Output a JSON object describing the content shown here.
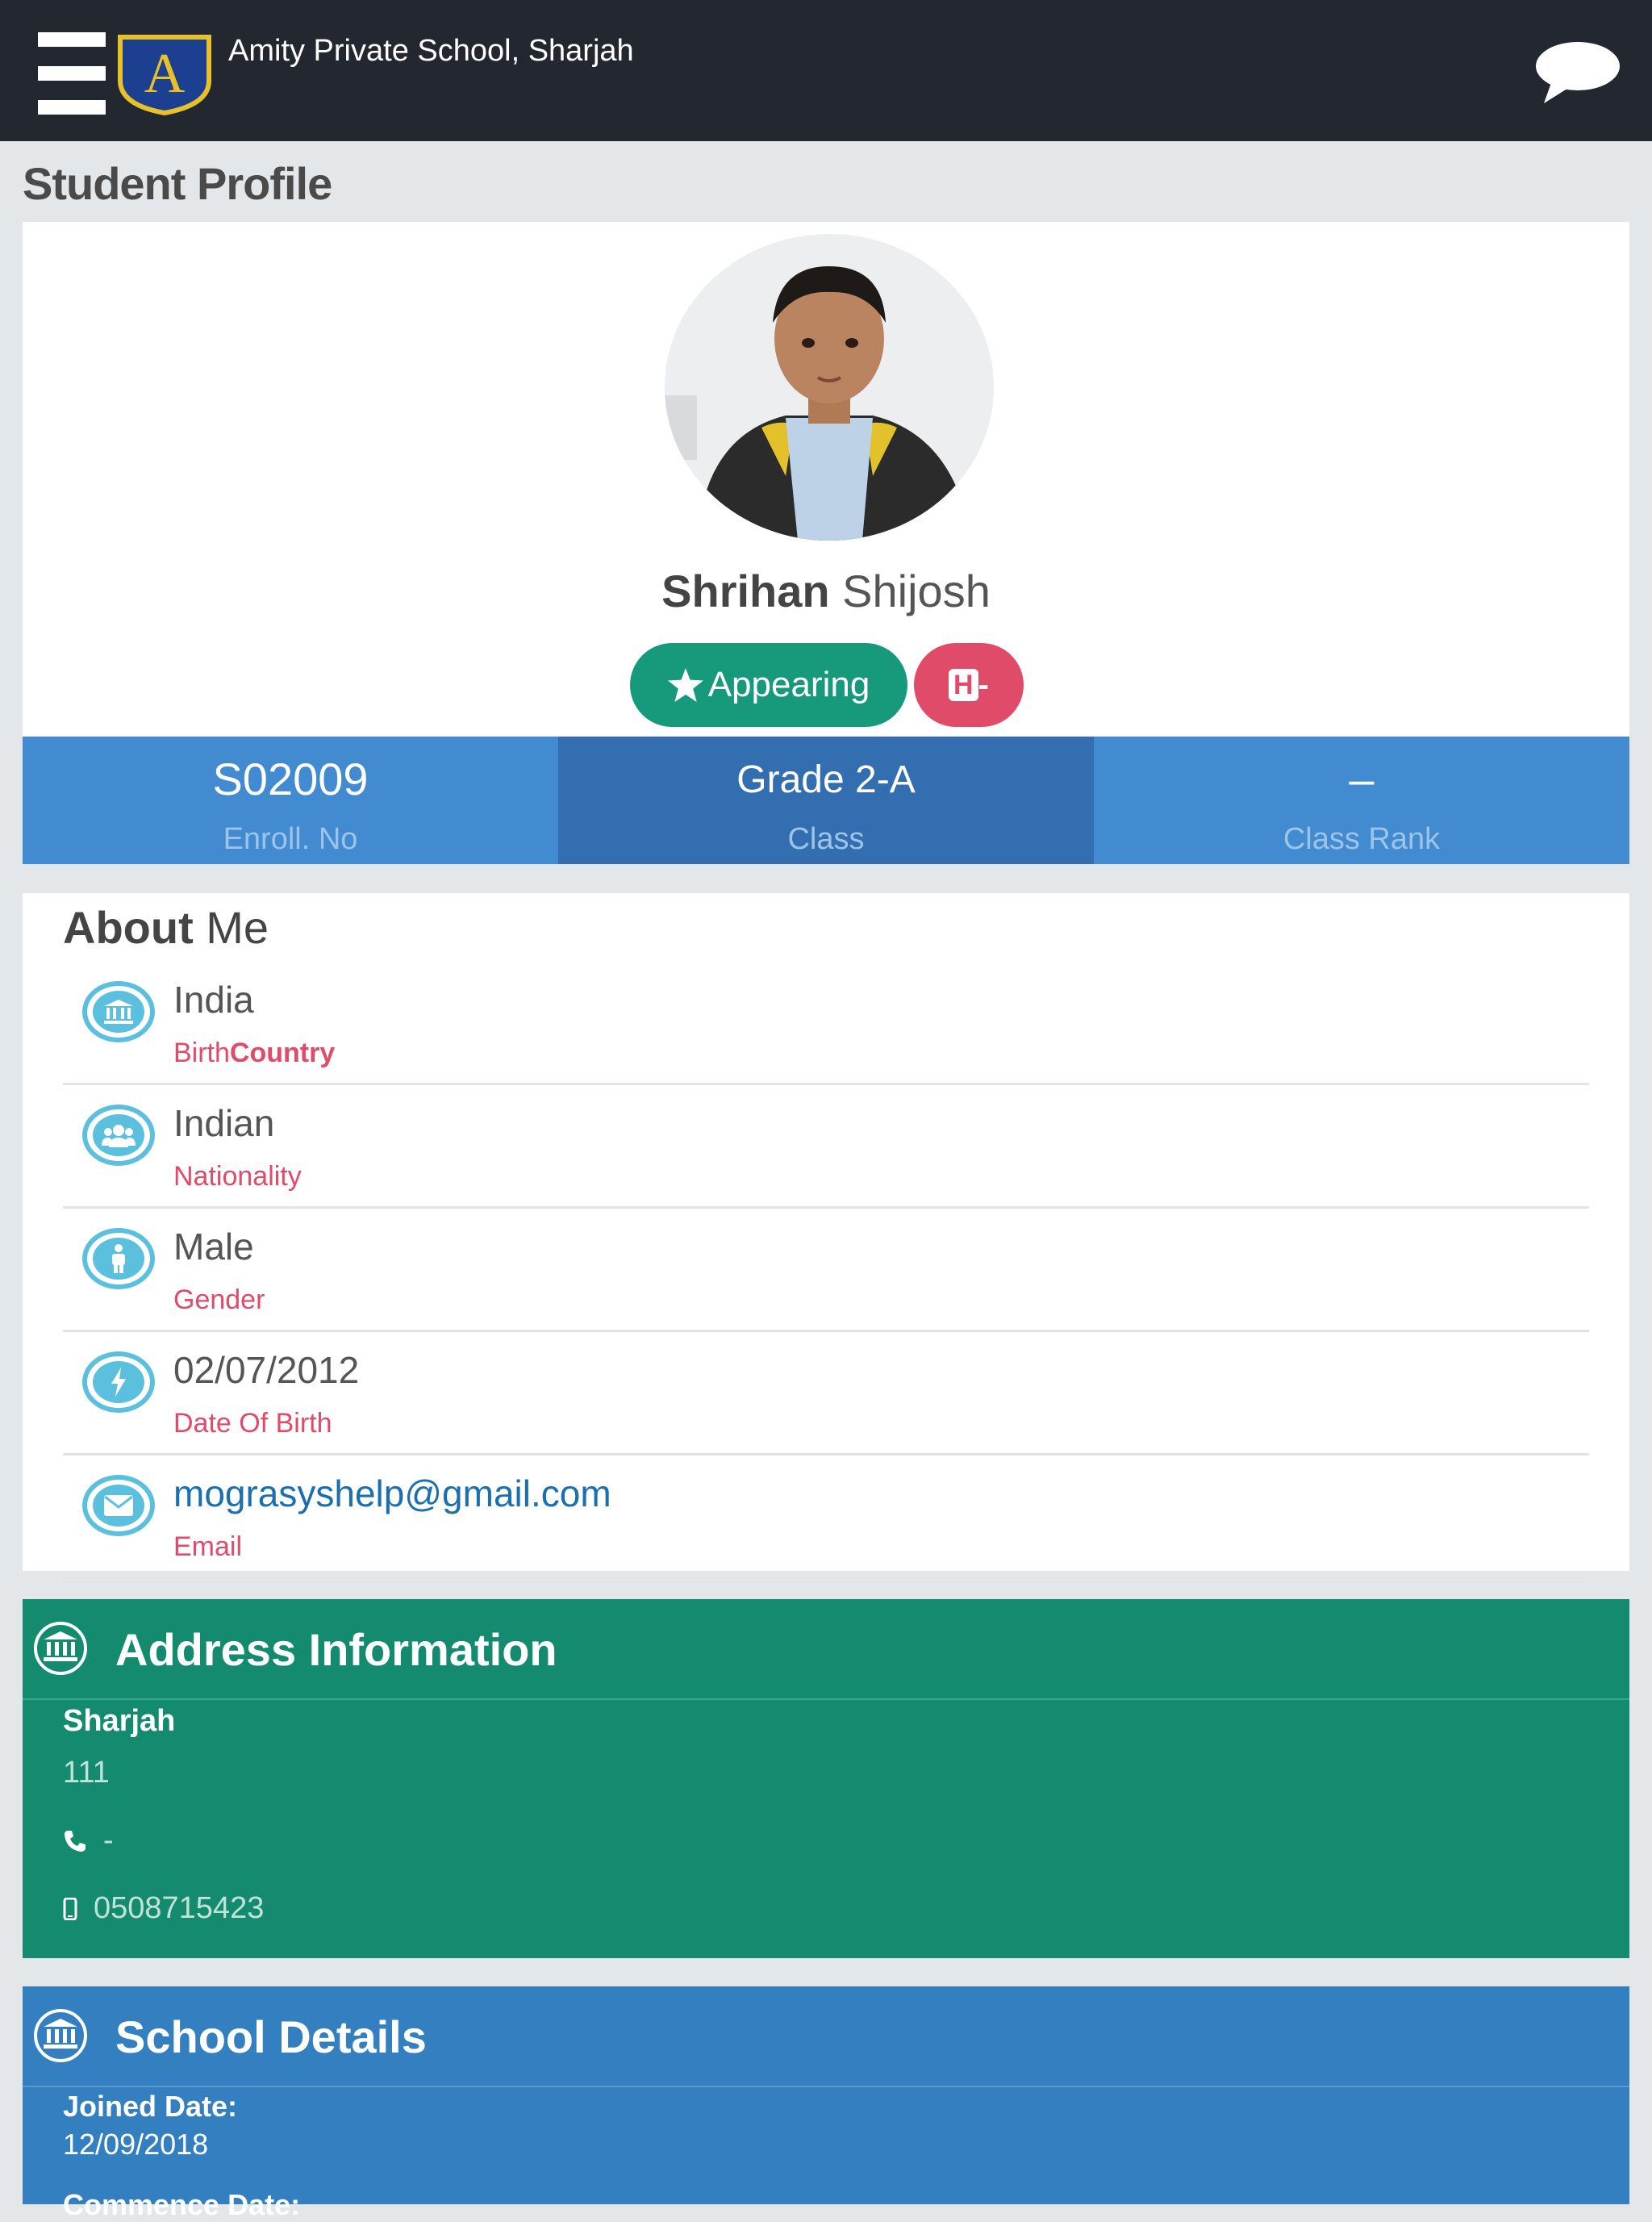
{
  "header": {
    "school_name": "Amity Private School, Sharjah",
    "logo_letter": "A"
  },
  "page": {
    "title": "Student Profile"
  },
  "profile": {
    "first_name": "Shrihan",
    "last_name": "Shijosh",
    "status_badge": "Appearing",
    "blood_group_prefix": "H",
    "blood_group": "-"
  },
  "stats": [
    {
      "value": "S02009",
      "label": "Enroll. No"
    },
    {
      "value": "Grade 2-A",
      "label": "Class"
    },
    {
      "value": "–",
      "label": "Class Rank"
    }
  ],
  "about": {
    "title_bold": "About",
    "title_rest": "Me",
    "rows": [
      {
        "icon": "bank-icon",
        "value": "India",
        "label": "Birth",
        "label_bold": "Country"
      },
      {
        "icon": "users-icon",
        "value": "Indian",
        "label": "Nationality"
      },
      {
        "icon": "person-icon",
        "value": "Male",
        "label": "Gender"
      },
      {
        "icon": "bolt-icon",
        "value": "02/07/2012",
        "label": "Date Of Birth"
      },
      {
        "icon": "envelope-icon",
        "value": "mograsyshelp@gmail.com",
        "label": "Email"
      }
    ]
  },
  "address": {
    "title": "Address Information",
    "city": "Sharjah",
    "line": "111",
    "phone": "-",
    "mobile": "0508715423"
  },
  "school": {
    "title": "School Details",
    "joined_label": "Joined Date:",
    "joined_date": "12/09/2018",
    "commence_label": "Commence Date:"
  },
  "colors": {
    "topbar": "#23272f",
    "stat_blue": "#428bd0",
    "stat_blue_dark": "#336fb0",
    "appearing_green": "#179a7c",
    "blood_red": "#e14b6a",
    "address_green": "#148b6f",
    "school_blue": "#347fc0",
    "icon_cyan": "#5bc0de"
  }
}
